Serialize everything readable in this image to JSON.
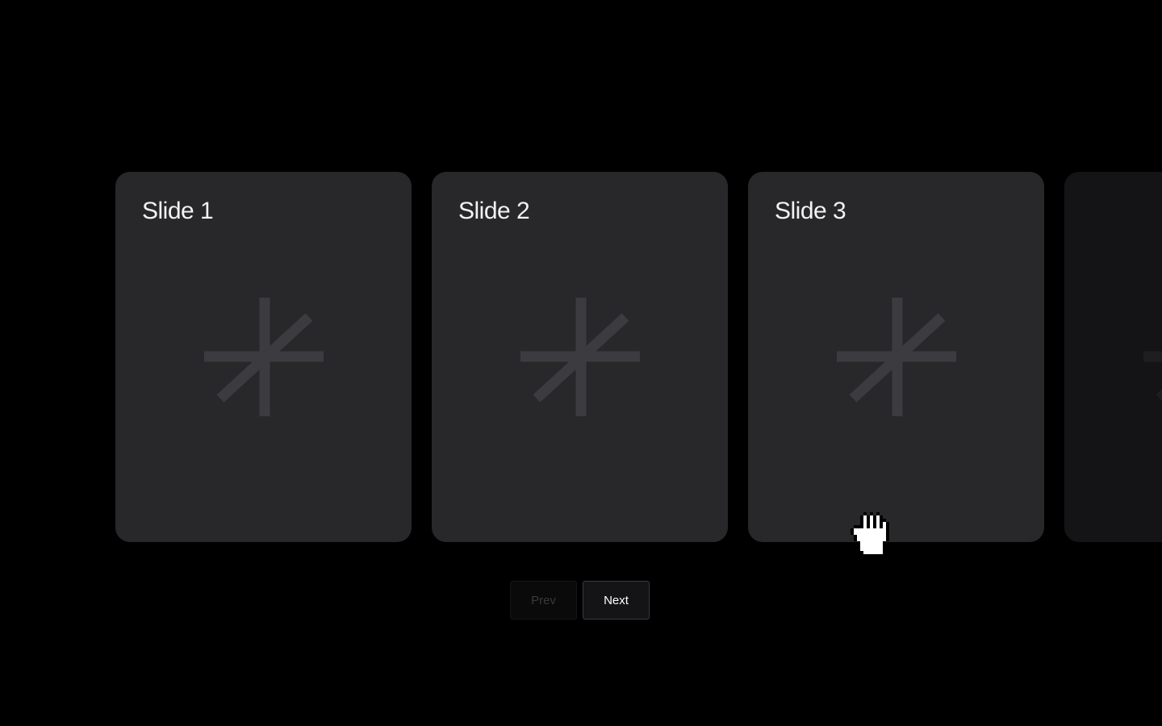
{
  "carousel": {
    "slides": [
      {
        "title": "Slide 1",
        "icon": "asterisk-icon"
      },
      {
        "title": "Slide 2",
        "icon": "asterisk-icon"
      },
      {
        "title": "Slide 3",
        "icon": "asterisk-icon"
      },
      {
        "title": "",
        "icon": "asterisk-icon"
      }
    ],
    "prev_label": "Prev",
    "next_label": "Next",
    "prev_disabled": true
  },
  "cursor": {
    "icon": "grab-hand-cursor-icon"
  },
  "colors": {
    "background": "#000000",
    "slide": "#28272a",
    "slide_dim": "#141416",
    "mark": "#3c3b3f",
    "text": "#f2f2f2"
  }
}
